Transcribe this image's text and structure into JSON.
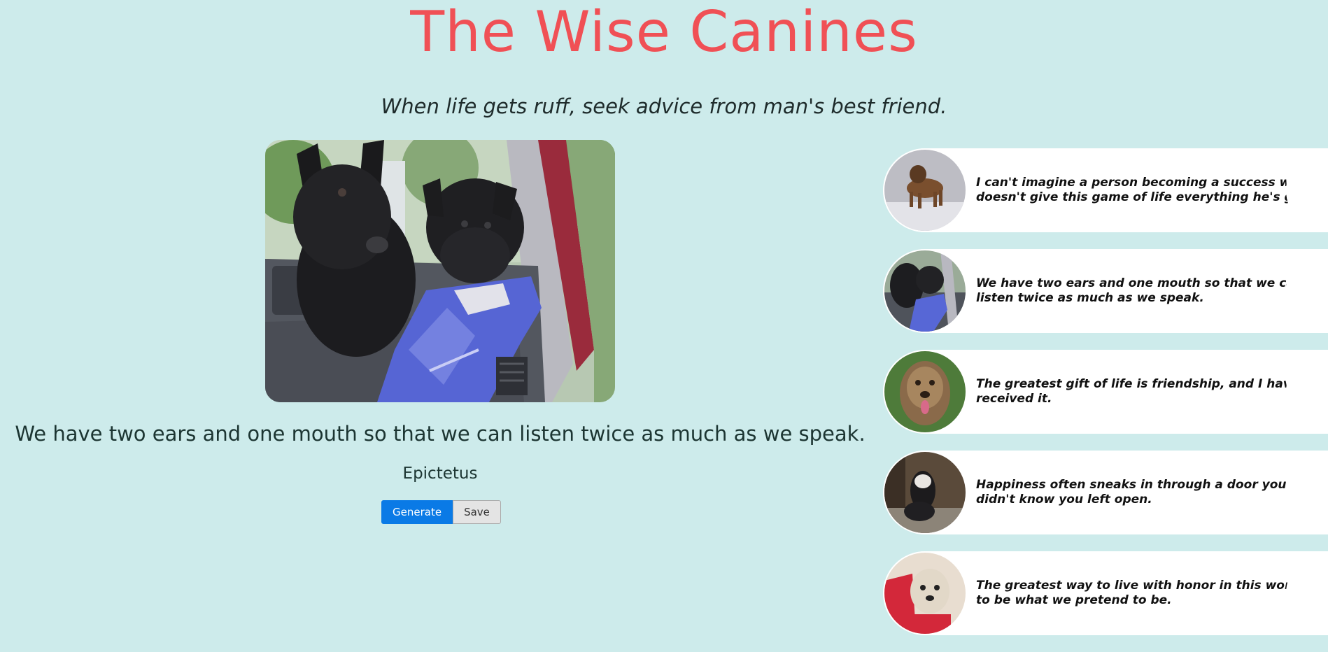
{
  "header": {
    "title": "The Wise Canines",
    "tagline": "When life gets ruff, seek advice from man's best friend."
  },
  "featured": {
    "image_icon": "two-scottish-terriers-in-car-photo",
    "quote": "We have two ears and one mouth so that we can listen twice as much as we speak.",
    "author": "Epictetus"
  },
  "actions": {
    "generate_label": "Generate",
    "save_label": "Save"
  },
  "colors": {
    "background": "#cdebeb",
    "title": "#f05055",
    "primary_button": "#0a7ae6"
  },
  "saved_quotes": [
    {
      "text": "I can't imagine a person becoming a success who doesn't give this game of life everything he's got.",
      "image_icon": "brown-dog-in-snow-photo"
    },
    {
      "text": "We have two ears and one mouth so that we can listen twice as much as we speak.",
      "image_icon": "two-scottish-terriers-in-car-photo"
    },
    {
      "text": "The greatest gift of life is friendship, and I have received it.",
      "image_icon": "shaggy-briard-dog-photo"
    },
    {
      "text": "Happiness often sneaks in through a door you didn't know you left open.",
      "image_icon": "long-haired-dog-on-rug-photo"
    },
    {
      "text": "The greatest way to live with honor in this world is to be what we pretend to be.",
      "image_icon": "cairn-terrier-in-red-coat-photo"
    }
  ]
}
